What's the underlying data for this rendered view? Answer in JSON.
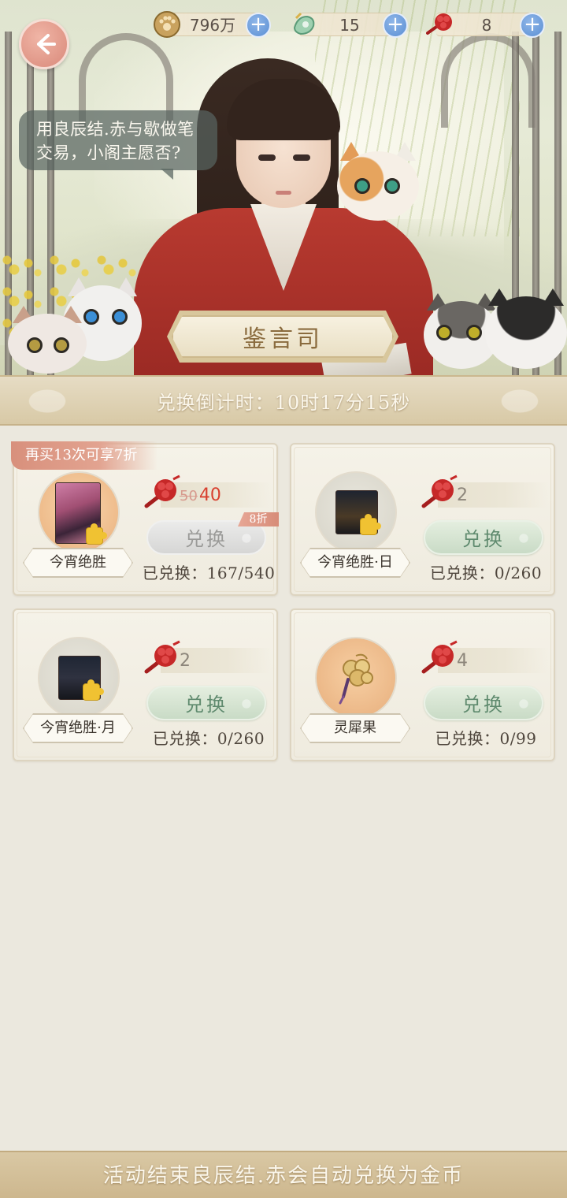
{
  "currencies": [
    {
      "icon": "paw-coin-icon",
      "value": "796万"
    },
    {
      "icon": "jade-pendant-icon",
      "value": "15"
    },
    {
      "icon": "red-seal-icon",
      "value": "8"
    }
  ],
  "speech_bubble": {
    "line1": "用良辰结.赤与歇做笔",
    "line2": "交易，小阁主愿否?"
  },
  "shop_name": "鉴言司",
  "countdown": "兑换倒计时：10时17分15秒",
  "promo_tag": "再买13次可享7折",
  "items": [
    {
      "name": "今宵绝胜",
      "price_old": "50",
      "price": "40",
      "discount_badge": "8折",
      "button_label": "兑换",
      "redeemed": "已兑换：167/540",
      "button_state": "disabled"
    },
    {
      "name": "今宵绝胜·日",
      "price": "2",
      "button_label": "兑换",
      "redeemed": "已兑换：0/260",
      "button_state": "active"
    },
    {
      "name": "今宵绝胜·月",
      "price": "2",
      "button_label": "兑换",
      "redeemed": "已兑换：0/260",
      "button_state": "active"
    },
    {
      "name": "灵犀果",
      "price": "4",
      "button_label": "兑换",
      "redeemed": "已兑换：0/99",
      "button_state": "active"
    }
  ],
  "footer_notice": "活动结束良辰结.赤会自动兑换为金币",
  "colors": {
    "accent_red": "#d8402f",
    "button_green": "#5f8a6e",
    "plus_blue": "#5b8fd4",
    "banner_gold": "#d8c9a6"
  }
}
